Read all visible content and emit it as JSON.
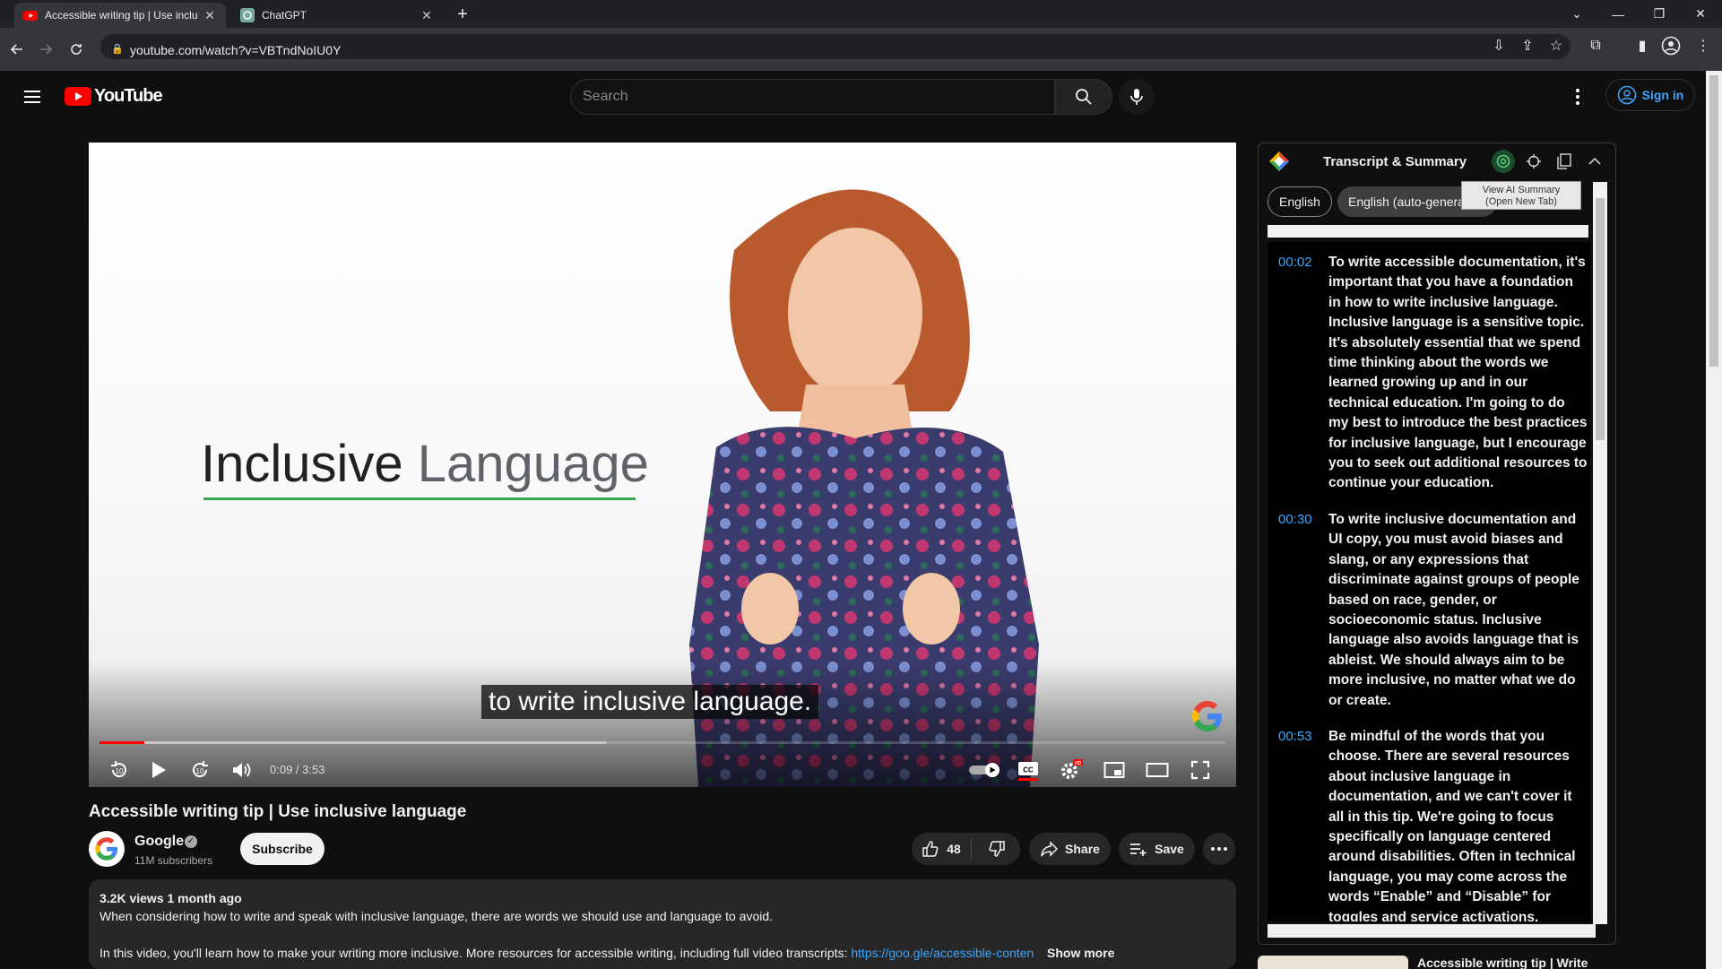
{
  "browser": {
    "tabs": [
      {
        "title": "Accessible writing tip | Use inclu",
        "active": true
      },
      {
        "title": "ChatGPT",
        "active": false
      }
    ],
    "url": "youtube.com/watch?v=VBTndNoIU0Y"
  },
  "youtube": {
    "logo_text": "YouTube",
    "search_placeholder": "Search",
    "sign_in": "Sign in"
  },
  "video": {
    "overlay_title_word1": "Inclusive",
    "overlay_title_word2": "Language",
    "caption": "to write inclusive language.",
    "time": "0:09 / 3:53",
    "progress_played": 0.04,
    "progress_buffered": 0.45,
    "title": "Accessible writing tip | Use inclusive language"
  },
  "channel": {
    "name": "Google",
    "subscribers": "11M subscribers",
    "subscribe_label": "Subscribe"
  },
  "actions": {
    "like_count": "48",
    "share_label": "Share",
    "save_label": "Save"
  },
  "description": {
    "meta": "3.2K views  1 month ago",
    "line1": "When considering how to write and speak with inclusive language, there are words we should use and language to avoid.",
    "line2_prefix": "In this video, you'll learn how to make your writing more inclusive. More resources for accessible writing, including full video transcripts: ",
    "link": "https://goo.gle/accessible-conten",
    "show_more": "Show more"
  },
  "transcript_panel": {
    "title": "Transcript & Summary",
    "tooltip_line1": "View AI Summary",
    "tooltip_line2": "(Open New Tab)",
    "languages": [
      "English",
      "English (auto-generated)"
    ],
    "segments": [
      {
        "time": "00:02",
        "text": "To write accessible documentation, it's important that you have a foundation in how to write inclusive language. Inclusive language is a sensitive topic. It's absolutely essential that we spend time thinking about the words we learned growing up and in our technical education. I'm going to do my best to introduce the best practices for inclusive language, but I encourage you to seek out additional resources to continue your education."
      },
      {
        "time": "00:30",
        "text": "To write inclusive documentation and UI copy, you must avoid biases and slang, or any expressions that discriminate against groups of people based on race, gender, or socioeconomic status. Inclusive language also avoids language that is ableist. We should always aim to be more inclusive, no matter what we do or create."
      },
      {
        "time": "00:53",
        "text": "Be mindful of the words that you choose. There are several resources about inclusive language in documentation, and we can't cover it all in this tip. We're going to focus specifically on language centered around disabilities. Often in technical language, you may come across the words “Enable” and “Disable” for toggles and service activations."
      }
    ],
    "next_video_title": "Accessible writing tip | Write"
  },
  "colors": {
    "youtube_red": "#ff0000",
    "link_blue": "#3ea6ff",
    "underline_green": "#34a853"
  }
}
